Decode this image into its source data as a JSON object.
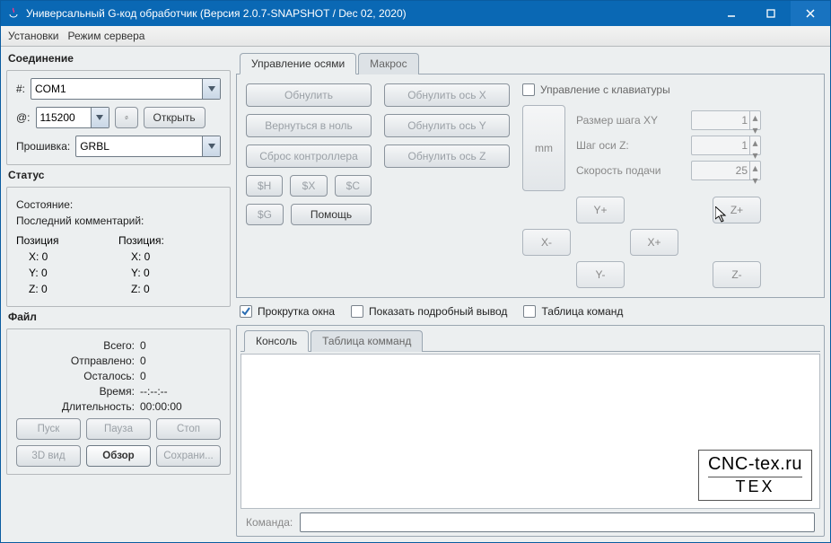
{
  "window": {
    "title": "Универсальный G-код обработчик (Версия 2.0.7-SNAPSHOT / Dec 02, 2020)"
  },
  "menu": {
    "settings": "Установки",
    "server": "Режим сервера"
  },
  "conn": {
    "title": "Соединение",
    "port_label": "#:",
    "port_value": "COM1",
    "baud_label": "@:",
    "baud_value": "115200",
    "open": "Открыть",
    "firmware_label": "Прошивка:",
    "firmware_value": "GRBL"
  },
  "status": {
    "title": "Статус",
    "state": "Состояние:",
    "last_comment": "Последний комментарий:",
    "pos1": "Позиция",
    "pos2": "Позиция:",
    "x": "X:  0",
    "y": "Y:  0",
    "z": "Z:  0",
    "x2": "X:  0",
    "y2": "Y:  0",
    "z2": "Z:  0"
  },
  "file": {
    "title": "Файл",
    "total_l": "Всего:",
    "total_v": "0",
    "sent_l": "Отправлено:",
    "sent_v": "0",
    "left_l": "Осталось:",
    "left_v": "0",
    "time_l": "Время:",
    "time_v": "--:--:--",
    "dur_l": "Длительность:",
    "dur_v": "00:00:00",
    "run": "Пуск",
    "pause": "Пауза",
    "stop": "Стоп",
    "view3d": "3D вид",
    "browse": "Обзор",
    "save": "Сохрани..."
  },
  "axis": {
    "tab_axis": "Управление осями",
    "tab_macro": "Макрос",
    "zero": "Обнулить",
    "zero_x": "Обнулить ось X",
    "zero_y": "Обнулить ось Y",
    "zero_z": "Обнулить ось Z",
    "return_zero": "Вернуться в ноль",
    "reset": "Сброс контроллера",
    "sh": "$H",
    "sx": "$X",
    "sc": "$C",
    "sg": "$G",
    "help": "Помощь",
    "kb_ctrl": "Управление с клавиатуры",
    "step_xy_l": "Размер шага XY",
    "step_xy_v": "1",
    "step_z_l": "Шаг оси Z:",
    "step_z_v": "1",
    "feed_l": "Скорость подачи",
    "feed_v": "25",
    "mm": "mm",
    "yp": "Y+",
    "ym": "Y-",
    "xp": "X+",
    "xm": "X-",
    "zp": "Z+",
    "zm": "Z-"
  },
  "out": {
    "scroll": "Прокрутка окна",
    "verbose": "Показать подробный вывод",
    "cmd_table": "Таблица команд",
    "tab_console": "Консоль",
    "tab_cmds": "Таблица комманд",
    "command_l": "Команда:"
  },
  "watermark": {
    "l1": "CNC-tex.ru",
    "l2": "TEX"
  }
}
